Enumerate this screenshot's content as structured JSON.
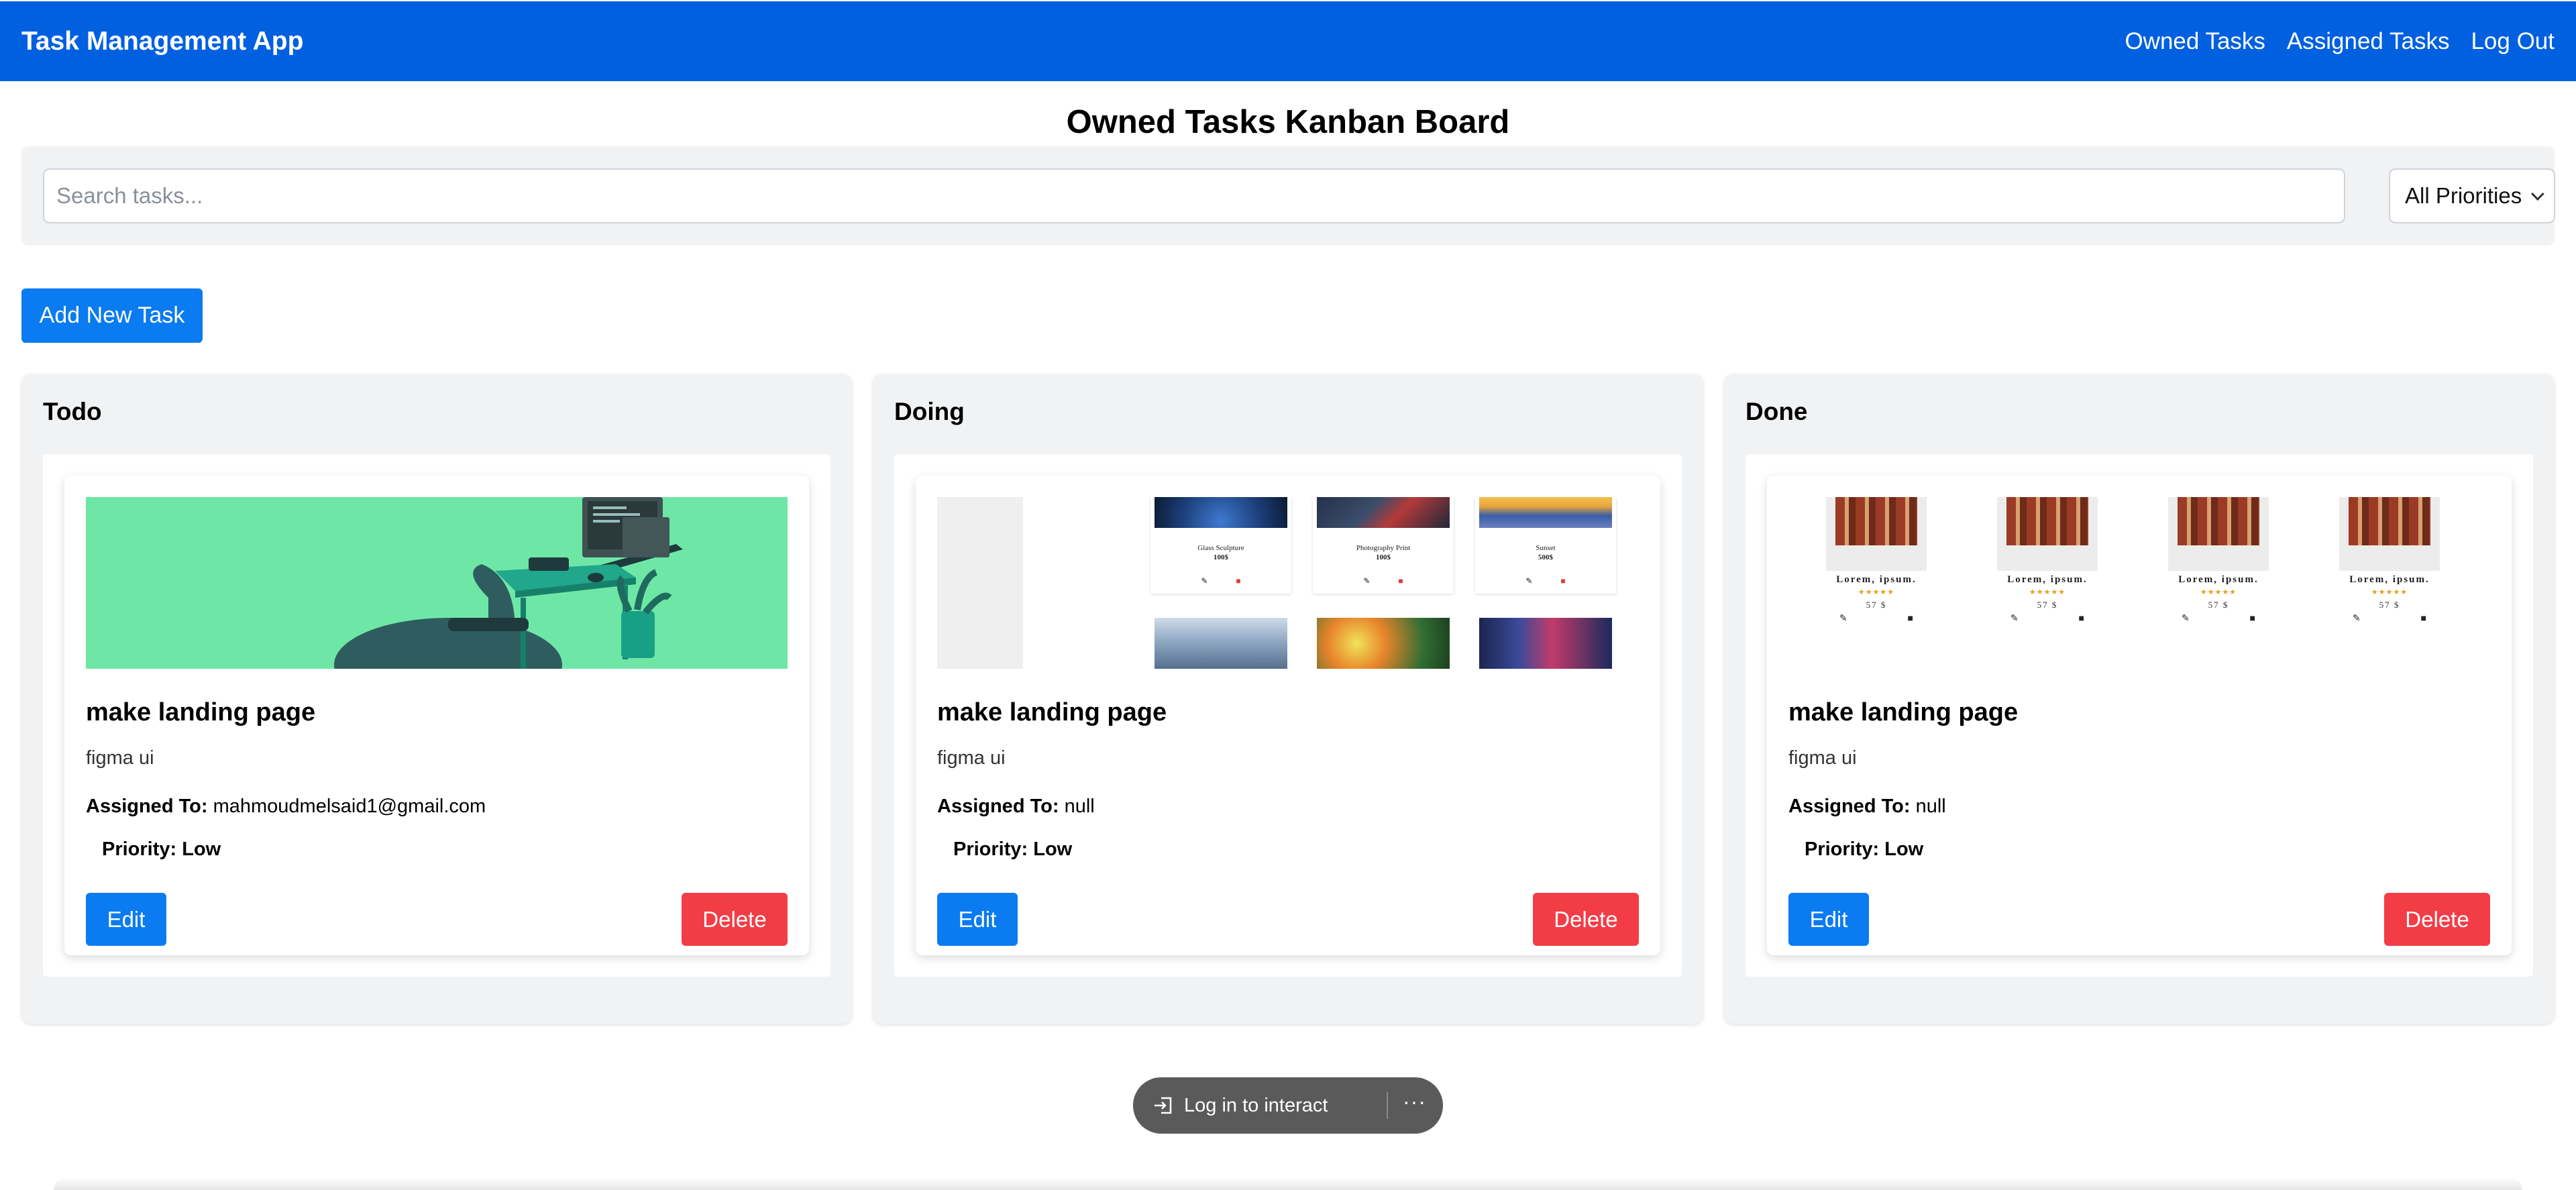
{
  "navbar": {
    "brand": "Task Management App",
    "links": [
      "Owned Tasks",
      "Assigned Tasks",
      "Log Out"
    ],
    "background_color": "#0060df"
  },
  "page": {
    "title": "Owned Tasks Kanban Board"
  },
  "search": {
    "placeholder": "Search tasks...",
    "value": ""
  },
  "filter": {
    "selected": "All Priorities"
  },
  "actions": {
    "add_task_label": "Add New Task"
  },
  "columns": [
    {
      "title": "Todo",
      "card": {
        "title": "make landing page",
        "description": "figma ui",
        "assigned_label": "Assigned To:",
        "assigned_value": "mahmoudmelsaid1@gmail.com",
        "priority": "Priority: Low",
        "edit_label": "Edit",
        "delete_label": "Delete",
        "media": "workspace-illustration"
      }
    },
    {
      "title": "Doing",
      "card": {
        "title": "make landing page",
        "description": "figma ui",
        "assigned_label": "Assigned To:",
        "assigned_value": "null",
        "priority": "Priority: Low",
        "edit_label": "Edit",
        "delete_label": "Delete",
        "media": "gallery-screenshot",
        "gallery_items": [
          {
            "name": "Glass Sculpture",
            "price": "100$"
          },
          {
            "name": "Photography Print",
            "price": "100$"
          },
          {
            "name": "Sunset",
            "price": "500$"
          }
        ]
      }
    },
    {
      "title": "Done",
      "card": {
        "title": "make landing page",
        "description": "figma ui",
        "assigned_label": "Assigned To:",
        "assigned_value": "null",
        "priority": "Priority: Low",
        "edit_label": "Edit",
        "delete_label": "Delete",
        "media": "product-grid-screenshot",
        "products": [
          {
            "name": "Lorem, ipsum.",
            "price": "57 $",
            "stars": "★★★★★"
          },
          {
            "name": "Lorem, ipsum.",
            "price": "57 $",
            "stars": "★★★★★"
          },
          {
            "name": "Lorem, ipsum.",
            "price": "57 $",
            "stars": "★★★★★"
          },
          {
            "name": "Lorem, ipsum.",
            "price": "57 $",
            "stars": "★★★★★"
          }
        ]
      }
    }
  ],
  "overlay": {
    "login_label": "Log in to interact",
    "more_label": "···"
  },
  "colors": {
    "primary": "#0a7bf0",
    "danger": "#f23d47",
    "panel": "#f1f2f4"
  }
}
